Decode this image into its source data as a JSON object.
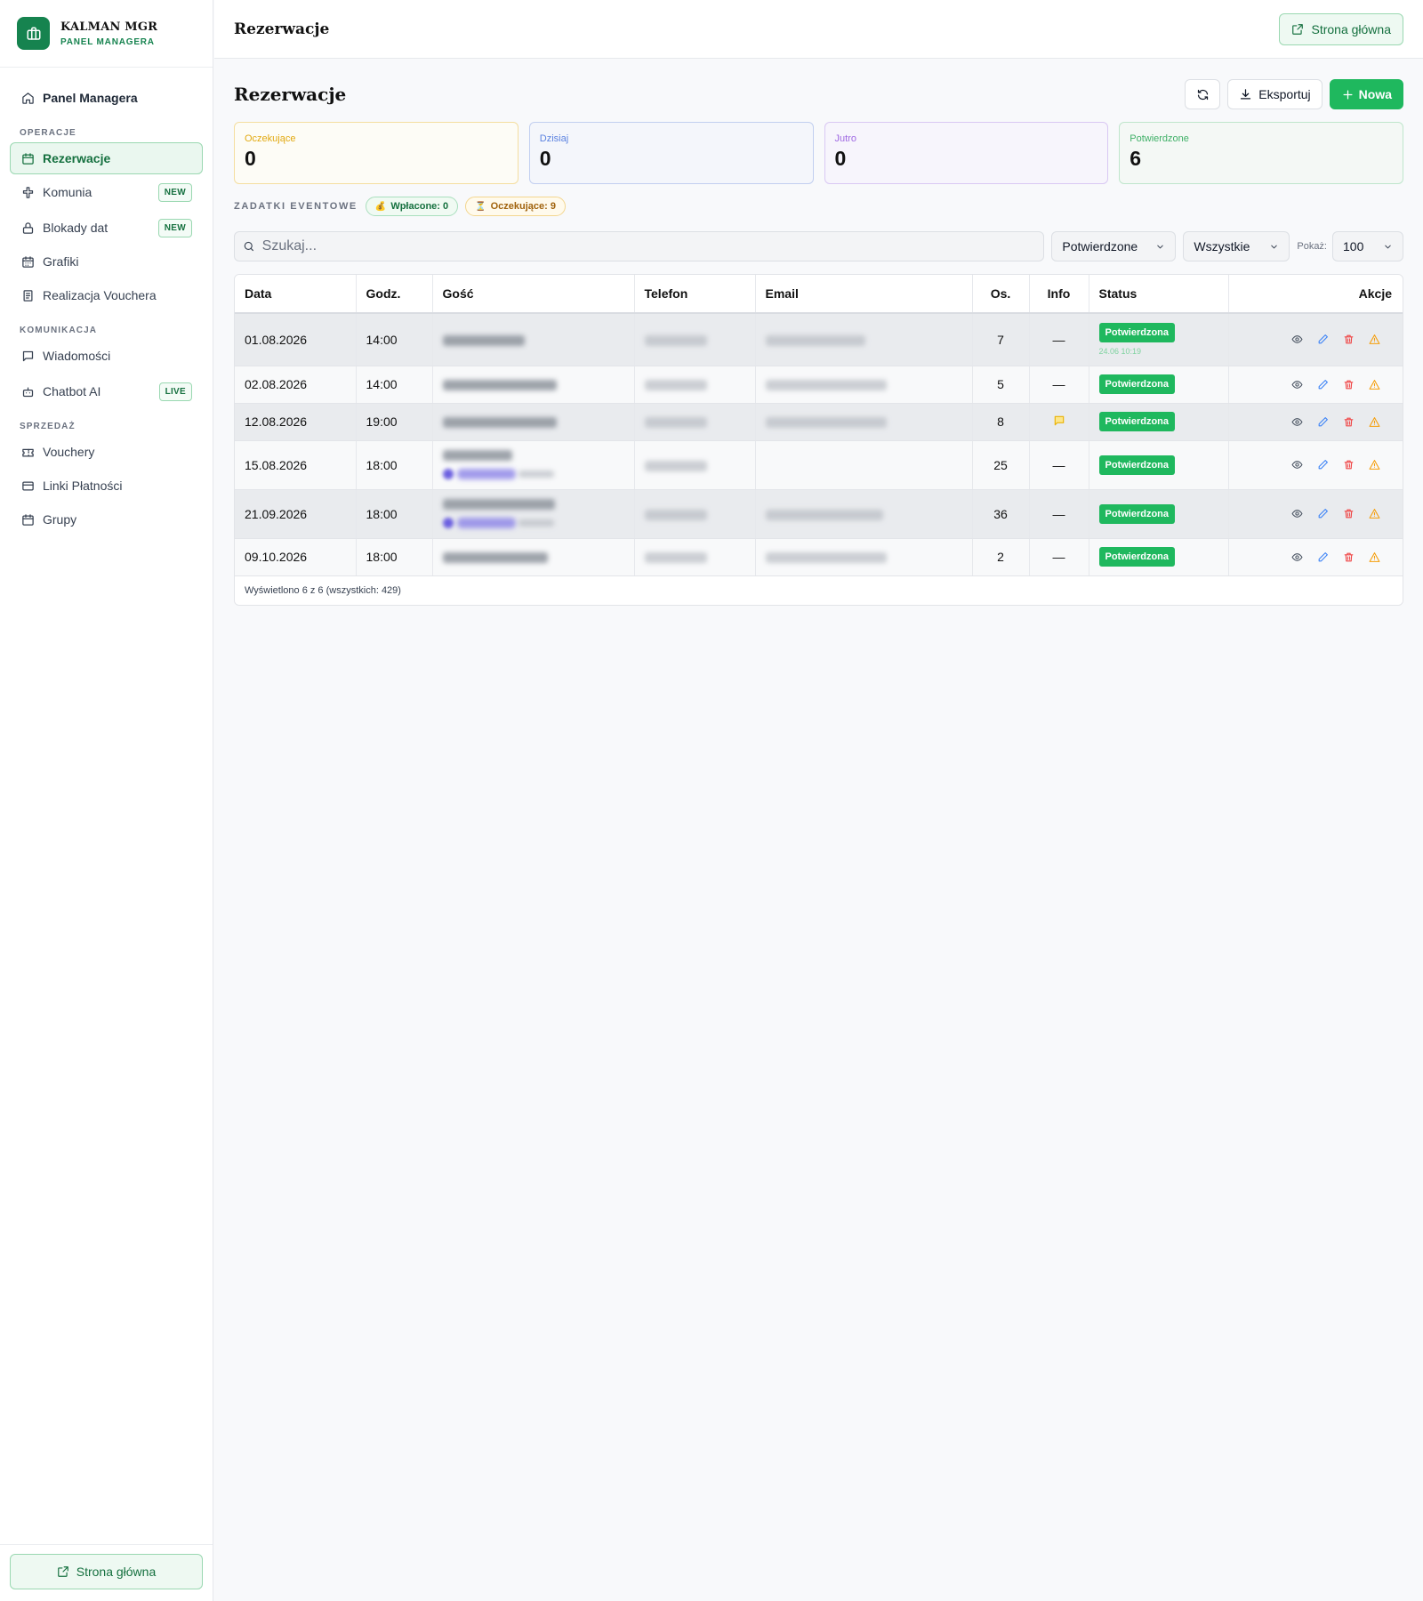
{
  "brand": {
    "title": "KALMAN MGR",
    "subtitle": "PANEL MANAGERA"
  },
  "sidebar": {
    "top_item": "Panel Managera",
    "sections": {
      "operacje": "OPERACJE",
      "komunikacja": "KOMUNIKACJA",
      "sprzedaz": "SPRZEDAŻ"
    },
    "items": {
      "rezerwacje": "Rezerwacje",
      "komunia": "Komunia",
      "komunia_badge": "NEW",
      "blokady": "Blokady dat",
      "blokady_badge": "NEW",
      "grafiki": "Grafiki",
      "realizacja": "Realizacja Vouchera",
      "wiadomosci": "Wiadomości",
      "chatbot": "Chatbot AI",
      "chatbot_badge": "LIVE",
      "vouchery": "Vouchery",
      "linki": "Linki Płatności",
      "grupy": "Grupy"
    },
    "footer_button": "Strona główna"
  },
  "topbar": {
    "title": "Rezerwacje",
    "home_button": "Strona główna"
  },
  "page": {
    "title": "Rezerwacje",
    "export_label": "Eksportuj",
    "new_label": "Nowa"
  },
  "stats": {
    "pending": {
      "label": "Oczekujące",
      "value": "0"
    },
    "today": {
      "label": "Dzisiaj",
      "value": "0"
    },
    "tomorrow": {
      "label": "Jutro",
      "value": "0"
    },
    "confirmed": {
      "label": "Potwierdzone",
      "value": "6"
    }
  },
  "deposits": {
    "label": "ZADATKI EVENTOWE",
    "paid": "Wpłacone: 0",
    "pending": "Oczekujące: 9"
  },
  "filters": {
    "search_placeholder": "Szukaj...",
    "status_value": "Potwierdzone",
    "type_value": "Wszystkie",
    "show_label": "Pokaż:",
    "show_value": "100"
  },
  "table": {
    "headers": {
      "date": "Data",
      "time": "Godz.",
      "guest": "Gość",
      "phone": "Telefon",
      "email": "Email",
      "people": "Os.",
      "info": "Info",
      "status": "Status",
      "actions": "Akcje"
    },
    "rows": [
      {
        "date": "01.08.2026",
        "time": "14:00",
        "people": "7",
        "info": "—",
        "status": "Potwierdzona",
        "status_sub": "24.06 10:19"
      },
      {
        "date": "02.08.2026",
        "time": "14:00",
        "people": "5",
        "info": "—",
        "status": "Potwierdzona"
      },
      {
        "date": "12.08.2026",
        "time": "19:00",
        "people": "8",
        "info": "",
        "status": "Potwierdzona"
      },
      {
        "date": "15.08.2026",
        "time": "18:00",
        "people": "25",
        "info": "—",
        "status": "Potwierdzona"
      },
      {
        "date": "21.09.2026",
        "time": "18:00",
        "people": "36",
        "info": "—",
        "status": "Potwierdzona"
      },
      {
        "date": "09.10.2026",
        "time": "18:00",
        "people": "2",
        "info": "—",
        "status": "Potwierdzona"
      }
    ],
    "footer": "Wyświetlono 6 z 6 (wszystkich: 429)"
  },
  "colors": {
    "brand_green": "#16834f",
    "primary_button": "#1fb85e",
    "status_confirmed": "#1fb85e"
  }
}
